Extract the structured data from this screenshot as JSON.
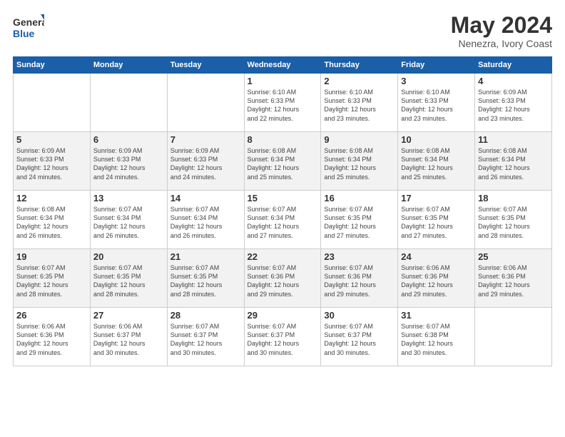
{
  "header": {
    "logo_general": "General",
    "logo_blue": "Blue",
    "month": "May 2024",
    "location": "Nenezra, Ivory Coast"
  },
  "weekdays": [
    "Sunday",
    "Monday",
    "Tuesday",
    "Wednesday",
    "Thursday",
    "Friday",
    "Saturday"
  ],
  "weeks": [
    [
      {
        "day": "",
        "info": ""
      },
      {
        "day": "",
        "info": ""
      },
      {
        "day": "",
        "info": ""
      },
      {
        "day": "1",
        "info": "Sunrise: 6:10 AM\nSunset: 6:33 PM\nDaylight: 12 hours\nand 22 minutes."
      },
      {
        "day": "2",
        "info": "Sunrise: 6:10 AM\nSunset: 6:33 PM\nDaylight: 12 hours\nand 23 minutes."
      },
      {
        "day": "3",
        "info": "Sunrise: 6:10 AM\nSunset: 6:33 PM\nDaylight: 12 hours\nand 23 minutes."
      },
      {
        "day": "4",
        "info": "Sunrise: 6:09 AM\nSunset: 6:33 PM\nDaylight: 12 hours\nand 23 minutes."
      }
    ],
    [
      {
        "day": "5",
        "info": "Sunrise: 6:09 AM\nSunset: 6:33 PM\nDaylight: 12 hours\nand 24 minutes."
      },
      {
        "day": "6",
        "info": "Sunrise: 6:09 AM\nSunset: 6:33 PM\nDaylight: 12 hours\nand 24 minutes."
      },
      {
        "day": "7",
        "info": "Sunrise: 6:09 AM\nSunset: 6:33 PM\nDaylight: 12 hours\nand 24 minutes."
      },
      {
        "day": "8",
        "info": "Sunrise: 6:08 AM\nSunset: 6:34 PM\nDaylight: 12 hours\nand 25 minutes."
      },
      {
        "day": "9",
        "info": "Sunrise: 6:08 AM\nSunset: 6:34 PM\nDaylight: 12 hours\nand 25 minutes."
      },
      {
        "day": "10",
        "info": "Sunrise: 6:08 AM\nSunset: 6:34 PM\nDaylight: 12 hours\nand 25 minutes."
      },
      {
        "day": "11",
        "info": "Sunrise: 6:08 AM\nSunset: 6:34 PM\nDaylight: 12 hours\nand 26 minutes."
      }
    ],
    [
      {
        "day": "12",
        "info": "Sunrise: 6:08 AM\nSunset: 6:34 PM\nDaylight: 12 hours\nand 26 minutes."
      },
      {
        "day": "13",
        "info": "Sunrise: 6:07 AM\nSunset: 6:34 PM\nDaylight: 12 hours\nand 26 minutes."
      },
      {
        "day": "14",
        "info": "Sunrise: 6:07 AM\nSunset: 6:34 PM\nDaylight: 12 hours\nand 26 minutes."
      },
      {
        "day": "15",
        "info": "Sunrise: 6:07 AM\nSunset: 6:34 PM\nDaylight: 12 hours\nand 27 minutes."
      },
      {
        "day": "16",
        "info": "Sunrise: 6:07 AM\nSunset: 6:35 PM\nDaylight: 12 hours\nand 27 minutes."
      },
      {
        "day": "17",
        "info": "Sunrise: 6:07 AM\nSunset: 6:35 PM\nDaylight: 12 hours\nand 27 minutes."
      },
      {
        "day": "18",
        "info": "Sunrise: 6:07 AM\nSunset: 6:35 PM\nDaylight: 12 hours\nand 28 minutes."
      }
    ],
    [
      {
        "day": "19",
        "info": "Sunrise: 6:07 AM\nSunset: 6:35 PM\nDaylight: 12 hours\nand 28 minutes."
      },
      {
        "day": "20",
        "info": "Sunrise: 6:07 AM\nSunset: 6:35 PM\nDaylight: 12 hours\nand 28 minutes."
      },
      {
        "day": "21",
        "info": "Sunrise: 6:07 AM\nSunset: 6:35 PM\nDaylight: 12 hours\nand 28 minutes."
      },
      {
        "day": "22",
        "info": "Sunrise: 6:07 AM\nSunset: 6:36 PM\nDaylight: 12 hours\nand 29 minutes."
      },
      {
        "day": "23",
        "info": "Sunrise: 6:07 AM\nSunset: 6:36 PM\nDaylight: 12 hours\nand 29 minutes."
      },
      {
        "day": "24",
        "info": "Sunrise: 6:06 AM\nSunset: 6:36 PM\nDaylight: 12 hours\nand 29 minutes."
      },
      {
        "day": "25",
        "info": "Sunrise: 6:06 AM\nSunset: 6:36 PM\nDaylight: 12 hours\nand 29 minutes."
      }
    ],
    [
      {
        "day": "26",
        "info": "Sunrise: 6:06 AM\nSunset: 6:36 PM\nDaylight: 12 hours\nand 29 minutes."
      },
      {
        "day": "27",
        "info": "Sunrise: 6:06 AM\nSunset: 6:37 PM\nDaylight: 12 hours\nand 30 minutes."
      },
      {
        "day": "28",
        "info": "Sunrise: 6:07 AM\nSunset: 6:37 PM\nDaylight: 12 hours\nand 30 minutes."
      },
      {
        "day": "29",
        "info": "Sunrise: 6:07 AM\nSunset: 6:37 PM\nDaylight: 12 hours\nand 30 minutes."
      },
      {
        "day": "30",
        "info": "Sunrise: 6:07 AM\nSunset: 6:37 PM\nDaylight: 12 hours\nand 30 minutes."
      },
      {
        "day": "31",
        "info": "Sunrise: 6:07 AM\nSunset: 6:38 PM\nDaylight: 12 hours\nand 30 minutes."
      },
      {
        "day": "",
        "info": ""
      }
    ]
  ]
}
